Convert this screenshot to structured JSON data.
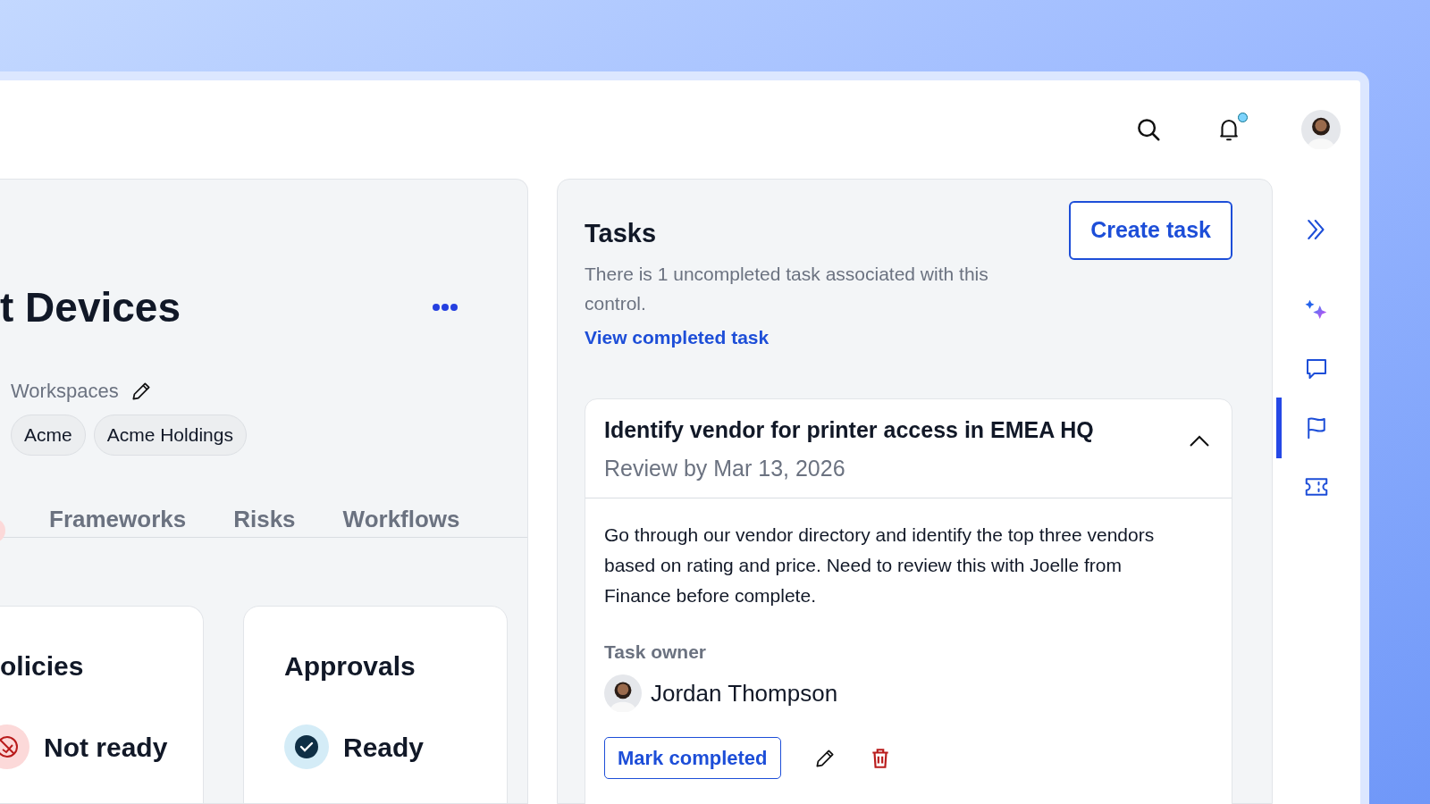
{
  "control": {
    "title": "t Devices",
    "workspaces_label": "Workspaces",
    "workspaces": [
      "Acme",
      "Acme Holdings"
    ],
    "tabs": [
      {
        "label": "Frameworks",
        "selected": false
      },
      {
        "label": "Risks",
        "selected": false
      },
      {
        "label": "Workflows",
        "selected": false
      }
    ],
    "cards": [
      {
        "title": "olicies",
        "status": "Not ready",
        "kind": "not_ready"
      },
      {
        "title": "Approvals",
        "status": "Ready",
        "kind": "ready"
      }
    ]
  },
  "tasks": {
    "title": "Tasks",
    "create_button": "Create task",
    "summary": "There is 1 uncompleted task associated with this control.",
    "view_completed_link": "View completed task",
    "items": [
      {
        "title": "Identify vendor for printer access in EMEA HQ",
        "review_by": "Review by Mar 13, 2026",
        "expanded": true,
        "description": "Go through our vendor directory and identify the top three vendors based on rating and price. Need to review this with Joelle from Finance before complete.",
        "owner_label": "Task owner",
        "owner": "Jordan Thompson",
        "complete_button": "Mark completed"
      }
    ]
  },
  "rail": [
    {
      "kind": "collapse",
      "selected": false
    },
    {
      "kind": "ai",
      "selected": false
    },
    {
      "kind": "comments",
      "selected": false
    },
    {
      "kind": "flags",
      "selected": true
    },
    {
      "kind": "ticket",
      "selected": false
    }
  ]
}
